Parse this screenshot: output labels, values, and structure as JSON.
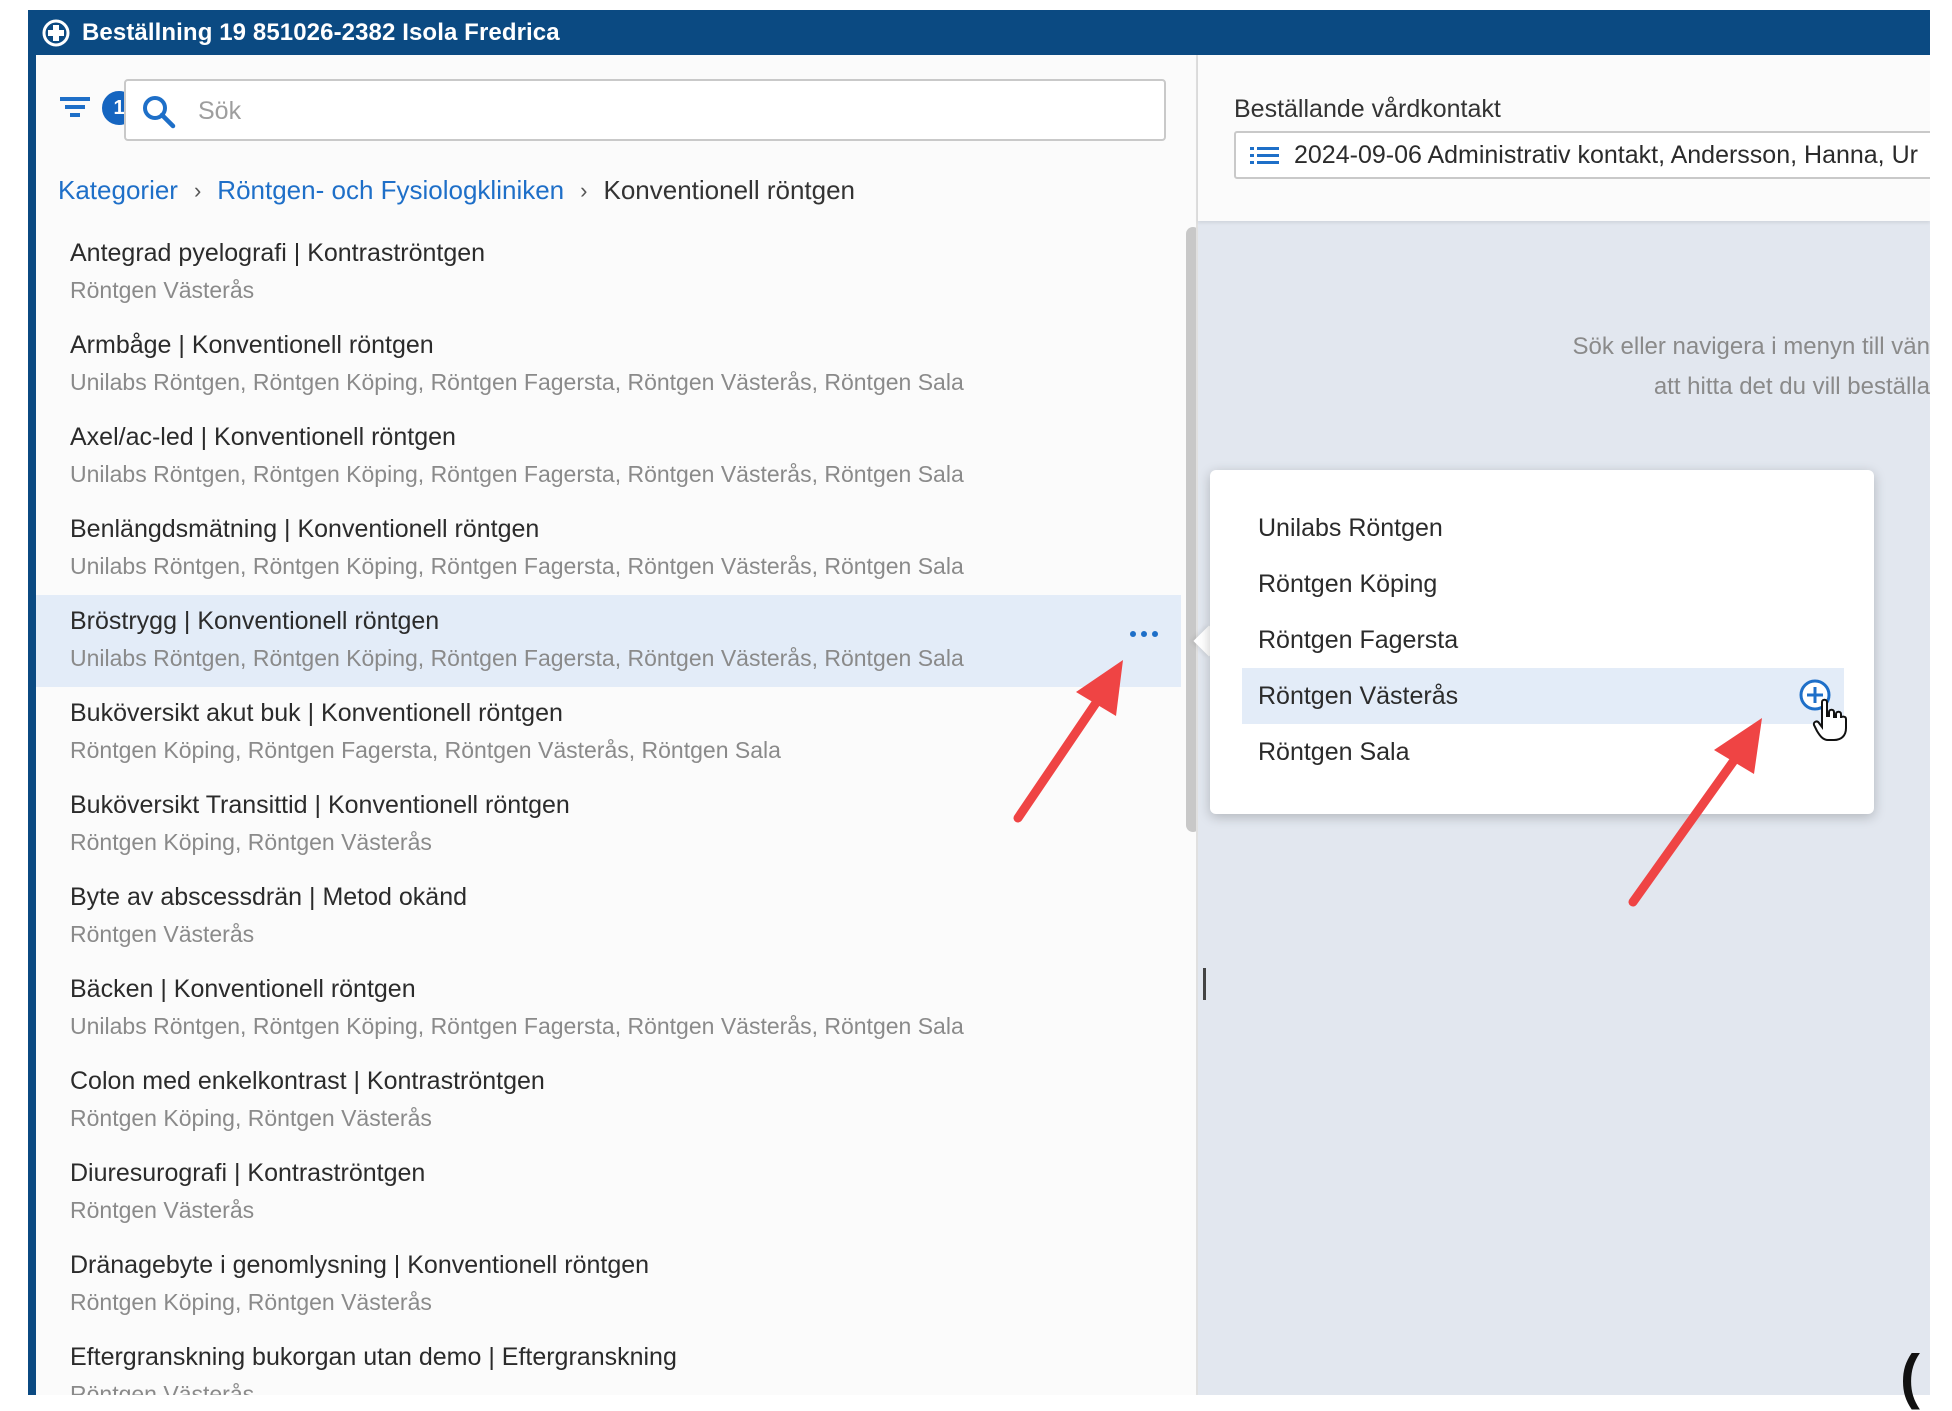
{
  "window": {
    "title": "Beställning 19 851026-2382 Isola Fredrica",
    "accent_color": "#0b4a82",
    "link_color": "#1e6fc8"
  },
  "filter": {
    "icon": "filter-icon",
    "badge_count": "1"
  },
  "search": {
    "placeholder": "Sök",
    "value": ""
  },
  "breadcrumb": {
    "items": [
      "Kategorier",
      "Röntgen- och Fysiologkliniken"
    ],
    "current": "Konventionell röntgen",
    "separator": "›"
  },
  "list": [
    {
      "title": "Antegrad pyelografi | Kontraströntgen",
      "locations": "Röntgen Västerås"
    },
    {
      "title": "Armbåge | Konventionell röntgen",
      "locations": "Unilabs Röntgen, Röntgen Köping, Röntgen Fagersta, Röntgen Västerås, Röntgen Sala"
    },
    {
      "title": "Axel/ac-led | Konventionell röntgen",
      "locations": "Unilabs Röntgen, Röntgen Köping, Röntgen Fagersta, Röntgen Västerås, Röntgen Sala"
    },
    {
      "title": "Benlängdsmätning | Konventionell röntgen",
      "locations": "Unilabs Röntgen, Röntgen Köping, Röntgen Fagersta, Röntgen Västerås, Röntgen Sala"
    },
    {
      "title": "Bröstrygg | Konventionell röntgen",
      "locations": "Unilabs Röntgen, Röntgen Köping, Röntgen Fagersta, Röntgen Västerås, Röntgen Sala",
      "selected": true
    },
    {
      "title": "Buköversikt akut buk | Konventionell röntgen",
      "locations": "Röntgen Köping, Röntgen Fagersta, Röntgen Västerås, Röntgen Sala"
    },
    {
      "title": "Buköversikt Transittid | Konventionell röntgen",
      "locations": "Röntgen Köping, Röntgen Västerås"
    },
    {
      "title": "Byte av abscessdrän | Metod okänd",
      "locations": "Röntgen Västerås"
    },
    {
      "title": "Bäcken | Konventionell röntgen",
      "locations": "Unilabs Röntgen, Röntgen Köping, Röntgen Fagersta, Röntgen Västerås, Röntgen Sala"
    },
    {
      "title": "Colon med enkelkontrast | Kontraströntgen",
      "locations": "Röntgen Köping, Röntgen Västerås"
    },
    {
      "title": "Diuresurografi | Kontraströntgen",
      "locations": "Röntgen Västerås"
    },
    {
      "title": "Dränagebyte i genomlysning | Konventionell röntgen",
      "locations": "Röntgen Köping, Röntgen Västerås"
    },
    {
      "title": "Eftergranskning bukorgan utan demo | Eftergranskning",
      "locations": "Röntgen Västerås"
    }
  ],
  "contact": {
    "label": "Beställande vårdkontakt",
    "value": "2024-09-06 Administrativ kontakt, Andersson, Hanna, Ur",
    "icon": "list-icon"
  },
  "hint": {
    "line1": "Sök eller navigera i menyn till vän",
    "line2": "att hitta det du vill beställa"
  },
  "popup": {
    "items": [
      "Unilabs Röntgen",
      "Röntgen Köping",
      "Röntgen Fagersta",
      "Röntgen Västerås",
      "Röntgen Sala"
    ],
    "selected_index": 3,
    "add_icon": "add-circle-icon"
  },
  "annotation_color": "#ef4444"
}
